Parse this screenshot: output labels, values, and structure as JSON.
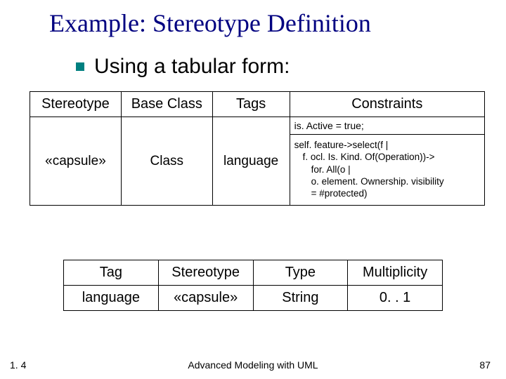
{
  "title": "Example: Stereotype Definition",
  "bullet": "Using a tabular form:",
  "table1": {
    "headers": {
      "c1": "Stereotype",
      "c2": "Base Class",
      "c3": "Tags",
      "c4": "Constraints"
    },
    "constraint_top": "is. Active = true;",
    "row": {
      "stereotype": "«capsule»",
      "base_class": "Class",
      "tags": "language"
    },
    "constraint_lines": {
      "l1": "self. feature->select(f |",
      "l2": "f. ocl. Is. Kind. Of(Operation))->",
      "l3": "for. All(o |",
      "l4": "o. element. Ownership. visibility",
      "l5": "= #protected)"
    }
  },
  "table2": {
    "headers": {
      "c1": "Tag",
      "c2": "Stereotype",
      "c3": "Type",
      "c4": "Multiplicity"
    },
    "row": {
      "tag": "language",
      "stereotype": "«capsule»",
      "type": "String",
      "multiplicity": "0. . 1"
    }
  },
  "footer": {
    "version": "1. 4",
    "center": "Advanced Modeling with UML",
    "page": "87"
  }
}
